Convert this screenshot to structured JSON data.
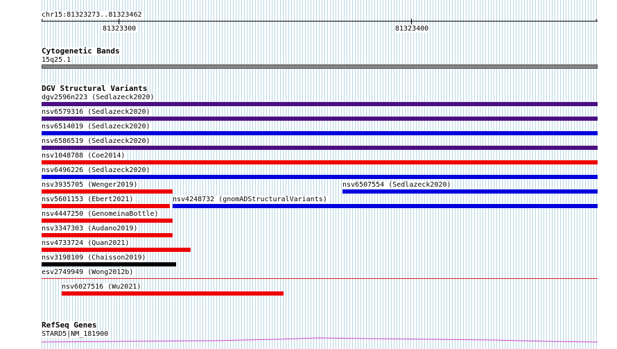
{
  "ruler": {
    "position": "chr15:81323273..81323462",
    "tick_labels": [
      "81323300",
      "81323400"
    ]
  },
  "cyto": {
    "title": "Cytogenetic Bands",
    "band_label": "15q25.1"
  },
  "dgv": {
    "title": "DGV Structural Variants",
    "features": [
      {
        "label": "dgv2596n223 (Sedlazeck2020)",
        "color": "#4b0f82"
      },
      {
        "label": "nsv6579316 (Sedlazeck2020)",
        "color": "#4b0f82"
      },
      {
        "label": "nsv6514019 (Sedlazeck2020)",
        "color": "#0000dd"
      },
      {
        "label": "nsv6586519 (Sedlazeck2020)",
        "color": "#4b0f82"
      },
      {
        "label": "nsv1048788 (Coe2014)",
        "color": "#ee0000"
      },
      {
        "label": "nsv6496226 (Sedlazeck2020)",
        "color": "#0000dd"
      },
      {
        "label": "nsv3935705 (Wenger2019)",
        "color": "#ee0000"
      },
      {
        "label": "nsv6507554 (Sedlazeck2020)",
        "color": "#0000dd"
      },
      {
        "label": "nsv5601153 (Ebert2021)",
        "color": "#ee0000"
      },
      {
        "label": "nsv4248732 (gnomADStructuralVariants)",
        "color": "#0000dd"
      },
      {
        "label": "nsv4447250 (GenomeinaBottle)",
        "color": "#ee0000"
      },
      {
        "label": "nsv3347303 (Audano2019)",
        "color": "#ee0000"
      },
      {
        "label": "nsv4733724 (Quan2021)",
        "color": "#ee0000"
      },
      {
        "label": "nsv3198109 (Chaisson2019)",
        "color": "#000000"
      },
      {
        "label": "esv2749949 (Wong2012b)",
        "color": "#d8202a"
      },
      {
        "label": "nsv6027516 (Wu2021)",
        "color": "#ee0000"
      }
    ]
  },
  "refseq": {
    "title": "RefSeq Genes",
    "gene_label": "STARD5|NM_181900",
    "color": "#cc44cc"
  }
}
